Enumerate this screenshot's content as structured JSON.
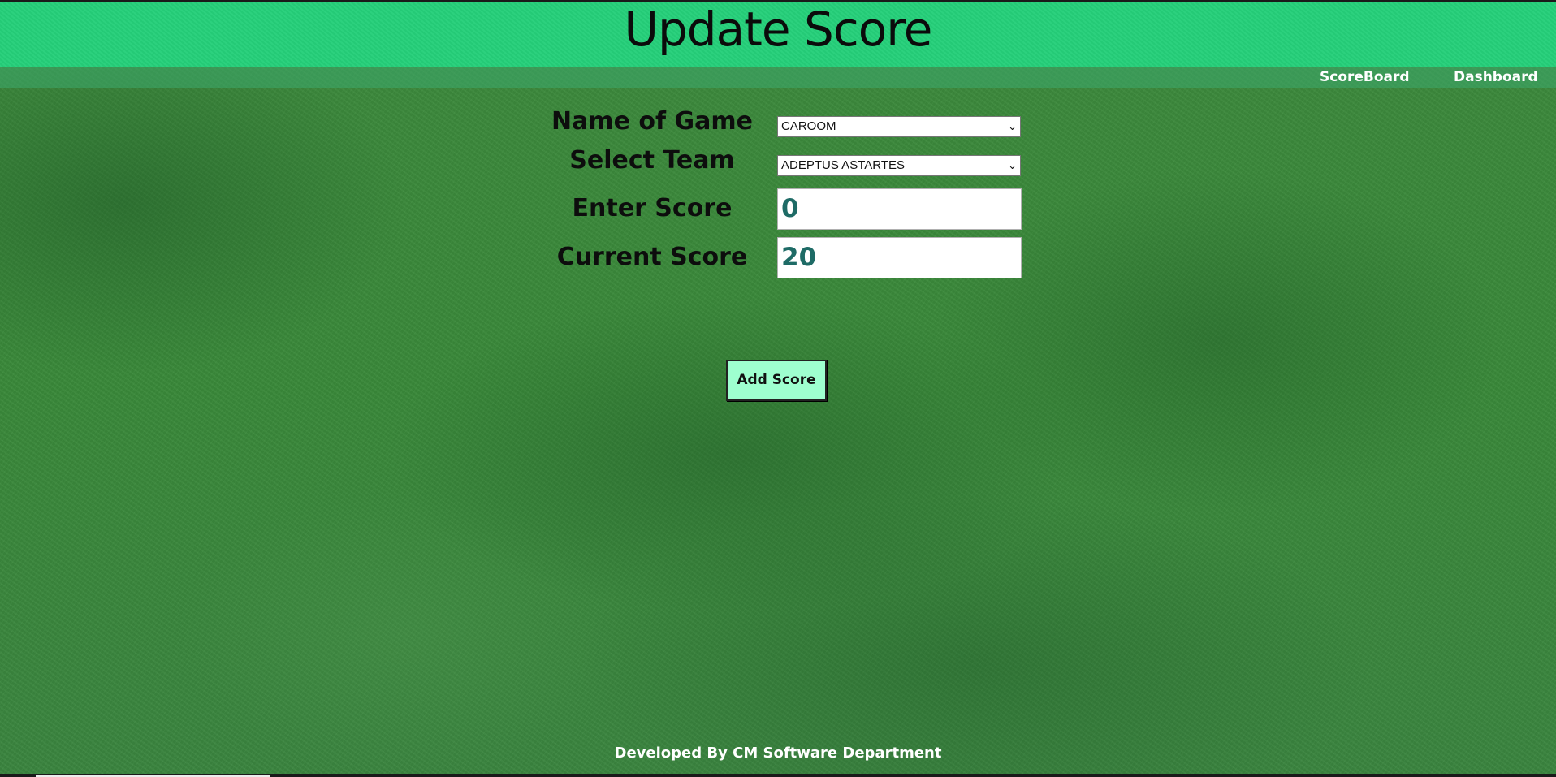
{
  "header": {
    "title": "Update Score"
  },
  "nav": {
    "scoreboard": "ScoreBoard",
    "dashboard": "Dashboard"
  },
  "form": {
    "game_label": "Name of Game",
    "game_selected": "CAROOM",
    "team_label": "Select Team",
    "team_selected": "ADEPTUS ASTARTES",
    "enter_score_label": "Enter Score",
    "enter_score_value": "0",
    "current_score_label": "Current Score",
    "current_score_value": "20",
    "submit_label": "Add Score"
  },
  "footer": {
    "text": "Developed By CM Software Department"
  },
  "colors": {
    "header_bg": "#25d07a",
    "button_bg": "#9effcf",
    "score_text": "#1e6b66",
    "grass": "#3f8a3f"
  }
}
